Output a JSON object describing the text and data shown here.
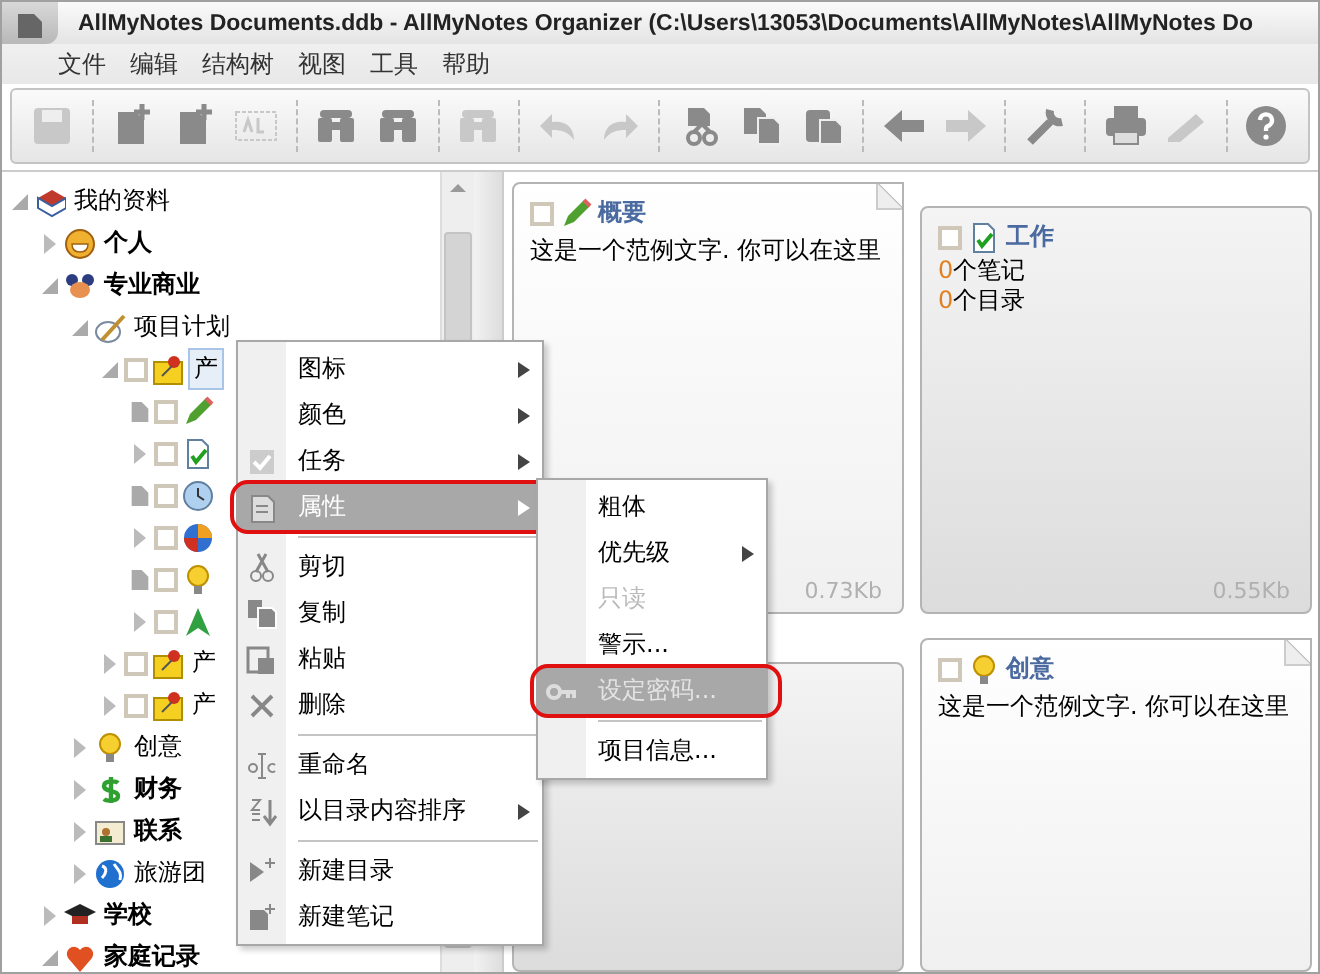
{
  "window": {
    "title": "AllMyNotes Documents.ddb - AllMyNotes Organizer (C:\\Users\\13053\\Documents\\AllMyNotes\\AllMyNotes Do"
  },
  "menu_bar": [
    "文件",
    "编辑",
    "结构树",
    "视图",
    "工具",
    "帮助"
  ],
  "toolbar": [
    {
      "kind": "button",
      "disabled": true
    },
    {
      "kind": "separator"
    },
    {
      "kind": "button",
      "disabled": false
    },
    {
      "kind": "button",
      "disabled": false
    },
    {
      "kind": "button",
      "disabled": true
    },
    {
      "kind": "separator"
    },
    {
      "kind": "button",
      "disabled": false
    },
    {
      "kind": "button",
      "disabled": false
    },
    {
      "kind": "separator"
    },
    {
      "kind": "button",
      "disabled": true
    },
    {
      "kind": "separator"
    },
    {
      "kind": "button",
      "disabled": true
    },
    {
      "kind": "button",
      "disabled": true
    },
    {
      "kind": "separator"
    },
    {
      "kind": "button",
      "disabled": false
    },
    {
      "kind": "button",
      "disabled": false
    },
    {
      "kind": "button",
      "disabled": false
    },
    {
      "kind": "separator"
    },
    {
      "kind": "button",
      "disabled": false
    },
    {
      "kind": "button",
      "disabled": true
    },
    {
      "kind": "separator"
    },
    {
      "kind": "button",
      "disabled": false
    },
    {
      "kind": "separator"
    },
    {
      "kind": "button",
      "disabled": false
    },
    {
      "kind": "button",
      "disabled": true
    },
    {
      "kind": "separator"
    },
    {
      "kind": "button",
      "disabled": false
    }
  ],
  "tree": [
    {
      "label": "我的资料",
      "bold": false,
      "kind": "folder",
      "expanded": true,
      "selected": false,
      "children": [
        {
          "label": "个人",
          "bold": true,
          "kind": "folder",
          "expanded": false,
          "selected": false
        },
        {
          "label": "专业商业",
          "bold": true,
          "kind": "folder",
          "expanded": true,
          "selected": false,
          "children": [
            {
              "label": "项目计划",
              "bold": false,
              "kind": "folder",
              "expanded": true,
              "selected": false,
              "children": [
                {
                  "label": "产",
                  "bold": false,
                  "kind": "folder",
                  "expanded": true,
                  "checked": false,
                  "selected": true,
                  "children": [
                    {
                      "kind": "note",
                      "checked": false
                    },
                    {
                      "kind": "folder",
                      "expanded": false,
                      "checked": false
                    },
                    {
                      "kind": "note",
                      "checked": false
                    },
                    {
                      "kind": "folder",
                      "expanded": false,
                      "checked": false
                    },
                    {
                      "kind": "note",
                      "checked": false
                    },
                    {
                      "kind": "folder",
                      "expanded": false,
                      "checked": false
                    }
                  ]
                },
                {
                  "label": "产",
                  "bold": false,
                  "kind": "folder",
                  "expanded": false,
                  "checked": false,
                  "selected": false
                },
                {
                  "label": "产",
                  "bold": false,
                  "kind": "folder",
                  "expanded": false,
                  "checked": false,
                  "selected": false
                }
              ]
            },
            {
              "label": "创意",
              "bold": false,
              "kind": "folder",
              "expanded": false,
              "selected": false
            },
            {
              "label": "财务",
              "bold": true,
              "kind": "folder",
              "expanded": false,
              "selected": false
            },
            {
              "label": "联系",
              "bold": true,
              "kind": "folder",
              "expanded": false,
              "selected": false
            },
            {
              "label": "旅游团",
              "bold": false,
              "kind": "folder",
              "expanded": false,
              "selected": false
            }
          ]
        },
        {
          "label": "学校",
          "bold": true,
          "kind": "folder",
          "expanded": false,
          "selected": false
        },
        {
          "label": "家庭记录",
          "bold": true,
          "kind": "folder",
          "expanded": true,
          "selected": false
        }
      ]
    }
  ],
  "cards": [
    {
      "kind": "note",
      "checked": false,
      "title": "概要",
      "text": "这是一个范例文字. 你可以在这里",
      "size": "0.73Kb"
    },
    {
      "kind": "folder",
      "checked": false,
      "title": "工作",
      "counts": [
        {
          "count": "0",
          "label": "个笔记"
        },
        {
          "count": "0",
          "label": "个目录"
        }
      ],
      "size": "0.55Kb"
    },
    {
      "kind": "folder"
    },
    {
      "kind": "note",
      "checked": false,
      "title": "创意",
      "text": "这是一个范例文字. 你可以在这里"
    }
  ],
  "context_menu": [
    {
      "kind": "item",
      "label": "图标",
      "submenu": true,
      "selected": false,
      "circled": false
    },
    {
      "kind": "item",
      "label": "颜色",
      "submenu": true,
      "selected": false,
      "circled": false
    },
    {
      "kind": "item",
      "label": "任务",
      "submenu": true,
      "selected": false,
      "circled": false
    },
    {
      "kind": "item",
      "label": "属性",
      "submenu": true,
      "selected": true,
      "circled": true
    },
    {
      "kind": "separator"
    },
    {
      "kind": "item",
      "label": "剪切",
      "submenu": false,
      "selected": false,
      "circled": false
    },
    {
      "kind": "item",
      "label": "复制",
      "submenu": false,
      "selected": false,
      "circled": false
    },
    {
      "kind": "item",
      "label": "粘贴",
      "submenu": false,
      "selected": false,
      "circled": false
    },
    {
      "kind": "item",
      "label": "删除",
      "submenu": false,
      "selected": false,
      "circled": false
    },
    {
      "kind": "separator"
    },
    {
      "kind": "item",
      "label": "重命名",
      "submenu": false,
      "selected": false,
      "circled": false
    },
    {
      "kind": "item",
      "label": "以目录内容排序",
      "submenu": true,
      "selected": false,
      "circled": false
    },
    {
      "kind": "separator"
    },
    {
      "kind": "item",
      "label": "新建目录",
      "submenu": false,
      "selected": false,
      "circled": false
    },
    {
      "kind": "item",
      "label": "新建笔记",
      "submenu": false,
      "selected": false,
      "circled": false
    }
  ],
  "submenu": [
    {
      "kind": "item",
      "label": "粗体",
      "submenu": false,
      "disabled": false,
      "selected": false,
      "circled": false
    },
    {
      "kind": "item",
      "label": "优先级",
      "submenu": true,
      "disabled": false,
      "selected": false,
      "circled": false
    },
    {
      "kind": "item",
      "label": "只读",
      "submenu": false,
      "disabled": true,
      "selected": false,
      "circled": false
    },
    {
      "kind": "item",
      "label": "警示...",
      "submenu": false,
      "disabled": false,
      "selected": false,
      "circled": false
    },
    {
      "kind": "item",
      "label": "设定密码...",
      "submenu": false,
      "disabled": true,
      "selected": true,
      "circled": true
    },
    {
      "kind": "separator"
    },
    {
      "kind": "item",
      "label": "项目信息...",
      "submenu": false,
      "disabled": false,
      "selected": false,
      "circled": false
    }
  ]
}
